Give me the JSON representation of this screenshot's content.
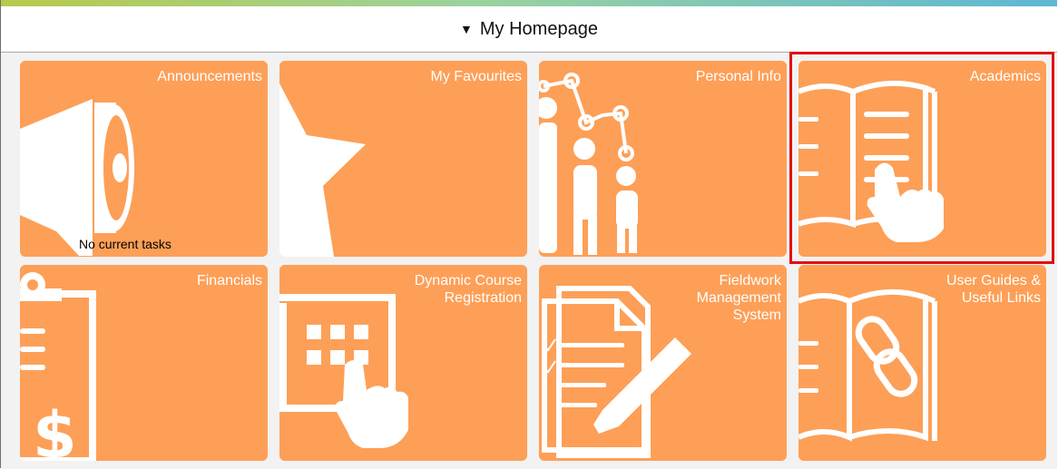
{
  "header": {
    "title": "My Homepage",
    "caret": "▼"
  },
  "tiles": [
    {
      "title": "Announcements",
      "note": "No current tasks",
      "icon": "megaphone-icon"
    },
    {
      "title": "My Favourites",
      "icon": "star-icon"
    },
    {
      "title": "Personal Info",
      "icon": "family-tree-icon"
    },
    {
      "title": "Academics",
      "icon": "book-pointer-icon",
      "highlighted": true
    },
    {
      "title": "Financials",
      "icon": "clipboard-dollar-icon"
    },
    {
      "title": "Dynamic Course\nRegistration",
      "icon": "calendar-pointer-icon"
    },
    {
      "title": "Fieldwork\nManagement\nSystem",
      "icon": "document-pencil-icon"
    },
    {
      "title": "User Guides &\nUseful Links",
      "icon": "book-link-icon"
    }
  ],
  "colors": {
    "tile_bg": "#fd9f57",
    "highlight": "#e01010",
    "icon": "#ffffff"
  }
}
